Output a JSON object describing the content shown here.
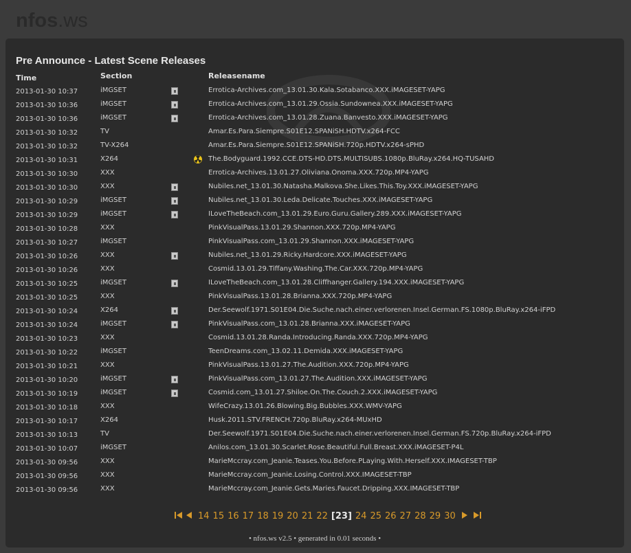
{
  "site": {
    "logo_main": "nfos",
    "logo_ext": ".ws"
  },
  "page": {
    "title": "Pre Announce - Latest Scene Releases"
  },
  "columns": {
    "time": "Time",
    "section": "Section",
    "releasename": "Releasename"
  },
  "releases": [
    {
      "time": "2013-01-30 10:37",
      "section": "iMGSET",
      "icon": "image-icon",
      "name": "Errotica-Archives.com_13.01.30.Kala.Sotabanco.XXX.iMAGESET-YAPG"
    },
    {
      "time": "2013-01-30 10:36",
      "section": "iMGSET",
      "icon": "image-icon",
      "name": "Errotica-Archives.com_13.01.29.Ossia.Sundowneа.XXX.iMAGESET-YAPG"
    },
    {
      "time": "2013-01-30 10:36",
      "section": "iMGSET",
      "icon": "image-icon",
      "name": "Errotica-Archives.com_13.01.28.Zuana.Banvesto.XXX.iMAGESET-YAPG"
    },
    {
      "time": "2013-01-30 10:32",
      "section": "TV",
      "icon": "",
      "name": "Amar.Es.Para.Siempre.S01E12.SPANiSH.HDTV.x264-FCC"
    },
    {
      "time": "2013-01-30 10:32",
      "section": "TV-X264",
      "icon": "",
      "name": "Amar.Es.Para.Siempre.S01E12.SPANiSH.720p.HDTV.x264-sPHD"
    },
    {
      "time": "2013-01-30 10:31",
      "section": "X264",
      "icon": "nuke-icon",
      "name": "The.Bodyguard.1992.CCE.DTS-HD.DTS.MULTISUBS.1080p.BluRay.x264.HQ-TUSAHD"
    },
    {
      "time": "2013-01-30 10:30",
      "section": "XXX",
      "icon": "",
      "name": "Errotica-Archives.13.01.27.Oliviana.Onoma.XXX.720p.MP4-YAPG"
    },
    {
      "time": "2013-01-30 10:30",
      "section": "XXX",
      "icon": "image-icon",
      "name": "Nubiles.net_13.01.30.Natasha.Malkova.She.Likes.This.Toy.XXX.iMAGESET-YAPG"
    },
    {
      "time": "2013-01-30 10:29",
      "section": "iMGSET",
      "icon": "image-icon",
      "name": "Nubiles.net_13.01.30.Leda.Delicate.Touches.XXX.iMAGESET-YAPG"
    },
    {
      "time": "2013-01-30 10:29",
      "section": "iMGSET",
      "icon": "image-icon",
      "name": "ILoveTheBeach.com_13.01.29.Euro.Guru.Gallery.289.XXX.iMAGESET-YAPG"
    },
    {
      "time": "2013-01-30 10:28",
      "section": "XXX",
      "icon": "",
      "name": "PinkVisualPass.13.01.29.Shannon.XXX.720p.MP4-YAPG"
    },
    {
      "time": "2013-01-30 10:27",
      "section": "iMGSET",
      "icon": "",
      "name": "PinkVisualPass.com_13.01.29.Shannon.XXX.iMAGESET-YAPG"
    },
    {
      "time": "2013-01-30 10:26",
      "section": "XXX",
      "icon": "image-icon",
      "name": "Nubiles.net_13.01.29.Ricky.Hardcore.XXX.iMAGESET-YAPG"
    },
    {
      "time": "2013-01-30 10:26",
      "section": "XXX",
      "icon": "",
      "name": "Cosmid.13.01.29.Tiffany.Washing.The.Car.XXX.720p.MP4-YAPG"
    },
    {
      "time": "2013-01-30 10:25",
      "section": "iMGSET",
      "icon": "image-icon",
      "name": "ILoveTheBeach.com_13.01.28.Cliffhanger.Gallery.194.XXX.iMAGESET-YAPG"
    },
    {
      "time": "2013-01-30 10:25",
      "section": "XXX",
      "icon": "",
      "name": "PinkVisualPass.13.01.28.Brianna.XXX.720p.MP4-YAPG"
    },
    {
      "time": "2013-01-30 10:24",
      "section": "X264",
      "icon": "image-icon",
      "name": "Der.Seewolf.1971.S01E04.Die.Suche.nach.einer.verlorenen.Insel.German.FS.1080p.BluRay.x264-iFPD"
    },
    {
      "time": "2013-01-30 10:24",
      "section": "iMGSET",
      "icon": "image-icon",
      "name": "PinkVisualPass.com_13.01.28.Brianna.XXX.iMAGESET-YAPG"
    },
    {
      "time": "2013-01-30 10:23",
      "section": "XXX",
      "icon": "",
      "name": "Cosmid.13.01.28.Randa.Introducing.Randa.XXX.720p.MP4-YAPG"
    },
    {
      "time": "2013-01-30 10:22",
      "section": "iMGSET",
      "icon": "",
      "name": "TeenDreams.com_13.02.11.Demida.XXX.iMAGESET-YAPG"
    },
    {
      "time": "2013-01-30 10:21",
      "section": "XXX",
      "icon": "",
      "name": "PinkVisualPass.13.01.27.The.Audition.XXX.720p.MP4-YAPG"
    },
    {
      "time": "2013-01-30 10:20",
      "section": "iMGSET",
      "icon": "image-icon",
      "name": "PinkVisualPass.com_13.01.27.The.Audition.XXX.iMAGESET-YAPG"
    },
    {
      "time": "2013-01-30 10:19",
      "section": "iMGSET",
      "icon": "image-icon",
      "name": "Cosmid.com_13.01.27.Shiloe.On.The.Couch.2.XXX.iMAGESET-YAPG"
    },
    {
      "time": "2013-01-30 10:18",
      "section": "XXX",
      "icon": "",
      "name": "WifeCrazy.13.01.26.Blowing.Big.Bubbles.XXX.WMV-YAPG"
    },
    {
      "time": "2013-01-30 10:17",
      "section": "X264",
      "icon": "",
      "name": "Husk.2011.STV.FRENCH.720p.BluRay.x264-MUxHD"
    },
    {
      "time": "2013-01-30 10:13",
      "section": "TV",
      "icon": "",
      "name": "Der.Seewolf.1971.S01E04.Die.Suche.nach.einer.verlorenen.Insel.German.FS.720p.BluRay.x264-iFPD"
    },
    {
      "time": "2013-01-30 10:07",
      "section": "iMGSET",
      "icon": "",
      "name": "Anilos.com_13.01.30.Scarlet.Rose.Beautiful.Full.Breast.XXX.iMAGESET-P4L"
    },
    {
      "time": "2013-01-30 09:56",
      "section": "XXX",
      "icon": "",
      "name": "MarieMccray.com_Jeanie.Teases.You.Before.PLaying.With.Herself.XXX.IMAGESET-TBP"
    },
    {
      "time": "2013-01-30 09:56",
      "section": "XXX",
      "icon": "",
      "name": "MarieMccray.com_Jeanie.Losing.Control.XXX.IMAGESET-TBP"
    },
    {
      "time": "2013-01-30 09:56",
      "section": "XXX",
      "icon": "",
      "name": "MarieMccray.com_Jeanie.Gets.Maries.Faucet.Dripping.XXX.IMAGESET-TBP"
    }
  ],
  "pager": {
    "first_icon": "first-page-icon",
    "prev_icon": "prev-page-icon",
    "next_icon": "next-page-icon",
    "last_icon": "last-page-icon",
    "pages_before": [
      "14",
      "15",
      "16",
      "17",
      "18",
      "19",
      "20",
      "21",
      "22"
    ],
    "current": "[23]",
    "pages_after": [
      "24",
      "25",
      "26",
      "27",
      "28",
      "29",
      "30"
    ]
  },
  "footer": {
    "text": "• nfos.ws v2.5 • generated in 0.01 seconds •"
  }
}
